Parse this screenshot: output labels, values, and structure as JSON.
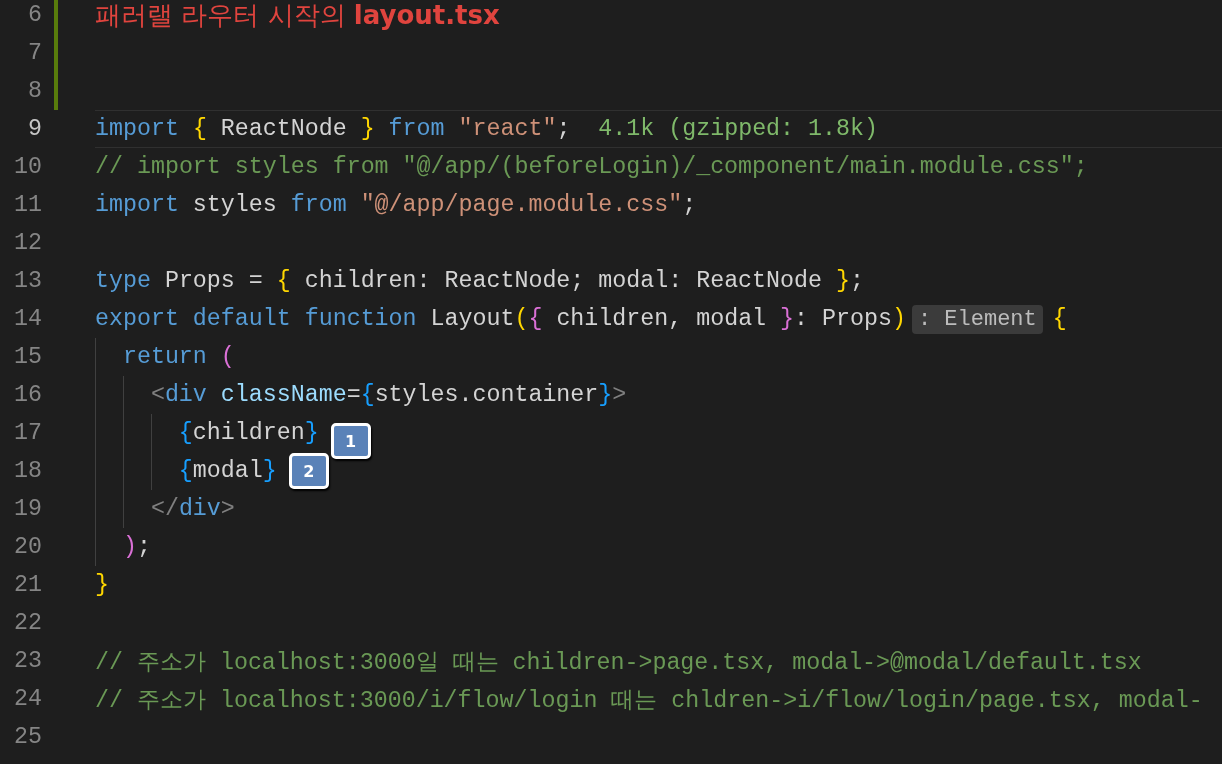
{
  "lines": [
    {
      "number": "6",
      "current": false,
      "added": true,
      "heading": "패러랠 라우터 시작의 **layout.tsx**"
    },
    {
      "number": "7",
      "current": false,
      "added": true
    },
    {
      "number": "8",
      "current": false,
      "added": true
    },
    {
      "number": "9",
      "current": true,
      "added": false,
      "tokens": [
        {
          "kind": "keyword",
          "text": "import "
        },
        {
          "kind": "bracket1",
          "text": "{"
        },
        {
          "kind": "ident",
          "text": " ReactNode "
        },
        {
          "kind": "bracket1",
          "text": "}"
        },
        {
          "kind": "keyword",
          "text": " from "
        },
        {
          "kind": "string",
          "text": "\"react\""
        },
        {
          "kind": "ident",
          "text": ";"
        },
        {
          "kind": "size",
          "text": "4.1k (gzipped: 1.8k)"
        }
      ]
    },
    {
      "number": "10",
      "current": false,
      "added": false,
      "tokens": [
        {
          "kind": "comment",
          "text": "// import styles from \"@/app/(beforeLogin)/_component/main.module.css\";"
        }
      ]
    },
    {
      "number": "11",
      "current": false,
      "added": false,
      "tokens": [
        {
          "kind": "keyword",
          "text": "import"
        },
        {
          "kind": "ident",
          "text": " styles "
        },
        {
          "kind": "keyword",
          "text": "from "
        },
        {
          "kind": "string",
          "text": "\"@/app/page.module.css\""
        },
        {
          "kind": "ident",
          "text": ";"
        }
      ]
    },
    {
      "number": "12",
      "current": false,
      "added": false
    },
    {
      "number": "13",
      "current": false,
      "added": false,
      "tokens": [
        {
          "kind": "keyword",
          "text": "type"
        },
        {
          "kind": "ident",
          "text": " Props = "
        },
        {
          "kind": "bracket1",
          "text": "{"
        },
        {
          "kind": "ident",
          "text": " children: ReactNode; modal: ReactNode "
        },
        {
          "kind": "bracket1",
          "text": "}"
        },
        {
          "kind": "ident",
          "text": ";"
        }
      ]
    },
    {
      "number": "14",
      "current": false,
      "added": false,
      "tokens": [
        {
          "kind": "keyword",
          "text": "export default function"
        },
        {
          "kind": "ident",
          "text": " Layout"
        },
        {
          "kind": "bracket1",
          "text": "("
        },
        {
          "kind": "bracket2",
          "text": "{"
        },
        {
          "kind": "ident",
          "text": " children, modal "
        },
        {
          "kind": "bracket2",
          "text": "}"
        },
        {
          "kind": "ident",
          "text": ": Props"
        },
        {
          "kind": "bracket1",
          "text": ")"
        },
        {
          "kind": "hint",
          "text": ": Element"
        },
        {
          "kind": "bracket1",
          "text": "{"
        }
      ]
    },
    {
      "number": "15",
      "current": false,
      "added": false,
      "tokens": [
        {
          "kind": "keyword",
          "text": "  return "
        },
        {
          "kind": "bracket2",
          "text": "("
        }
      ]
    },
    {
      "number": "16",
      "current": false,
      "added": false,
      "tokens": [
        {
          "kind": "tag",
          "text": "    <"
        },
        {
          "kind": "keyword",
          "text": "div"
        },
        {
          "kind": "attr",
          "text": " className"
        },
        {
          "kind": "ident",
          "text": "="
        },
        {
          "kind": "bracket3",
          "text": "{"
        },
        {
          "kind": "ident",
          "text": "styles.container"
        },
        {
          "kind": "bracket3",
          "text": "}"
        },
        {
          "kind": "tag",
          "text": ">"
        }
      ]
    },
    {
      "number": "17",
      "current": false,
      "added": false,
      "tokens": [
        {
          "kind": "bracket3",
          "text": "      {"
        },
        {
          "kind": "ident",
          "text": "children"
        },
        {
          "kind": "bracket3",
          "text": "}"
        },
        {
          "kind": "badge",
          "text": "1"
        }
      ]
    },
    {
      "number": "18",
      "current": false,
      "added": false,
      "tokens": [
        {
          "kind": "bracket3",
          "text": "      {"
        },
        {
          "kind": "ident",
          "text": "modal"
        },
        {
          "kind": "bracket3",
          "text": "}"
        },
        {
          "kind": "badge",
          "text": "2"
        }
      ]
    },
    {
      "number": "19",
      "current": false,
      "added": false,
      "tokens": [
        {
          "kind": "tag",
          "text": "    </"
        },
        {
          "kind": "keyword",
          "text": "div"
        },
        {
          "kind": "tag",
          "text": ">"
        }
      ]
    },
    {
      "number": "20",
      "current": false,
      "added": false,
      "tokens": [
        {
          "kind": "bracket2",
          "text": "  )"
        },
        {
          "kind": "ident",
          "text": ";"
        }
      ]
    },
    {
      "number": "21",
      "current": false,
      "added": false,
      "tokens": [
        {
          "kind": "bracket1",
          "text": "}"
        }
      ]
    },
    {
      "number": "22",
      "current": false,
      "added": false
    },
    {
      "number": "23",
      "current": false,
      "added": false,
      "tokens": [
        {
          "kind": "comment",
          "text": "// 주소가 localhost:3000일 때는 children->page.tsx, modal->@modal/default.tsx"
        }
      ]
    },
    {
      "number": "24",
      "current": false,
      "added": false,
      "tokens": [
        {
          "kind": "comment",
          "text": "// 주소가 localhost:3000/i/flow/login 때는 chldren->i/flow/login/page.tsx, modal-"
        }
      ]
    },
    {
      "number": "25",
      "current": false,
      "added": false
    }
  ]
}
